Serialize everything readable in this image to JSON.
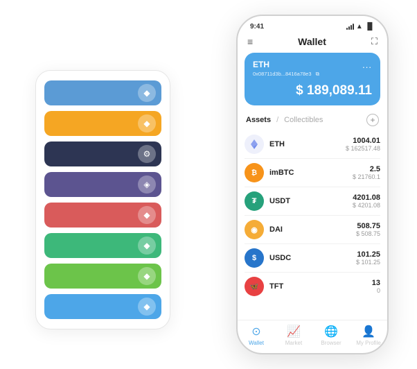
{
  "scene": {
    "card_stack": {
      "cards": [
        {
          "id": "blue",
          "class": "card-blue",
          "icon": "◆"
        },
        {
          "id": "orange",
          "class": "card-orange",
          "icon": "◆"
        },
        {
          "id": "dark",
          "class": "card-dark",
          "icon": "⚙"
        },
        {
          "id": "purple",
          "class": "card-purple",
          "icon": "◆"
        },
        {
          "id": "red",
          "class": "card-red",
          "icon": "◆"
        },
        {
          "id": "green",
          "class": "card-green",
          "icon": "◆"
        },
        {
          "id": "lightgreen",
          "class": "card-lightgreen",
          "icon": "◆"
        },
        {
          "id": "skyblue",
          "class": "card-skyblue",
          "icon": "◆"
        }
      ]
    },
    "phone": {
      "status_bar": {
        "time": "9:41",
        "battery": "▐",
        "wifi": "wifi",
        "signal": "signal"
      },
      "header": {
        "menu_icon": "≡",
        "title": "Wallet",
        "expand_icon": "⛶"
      },
      "eth_card": {
        "coin": "ETH",
        "address": "0x08711d3b...8416a78e3",
        "copy_icon": "⧉",
        "menu": "...",
        "currency": "$",
        "amount": "189,089.11"
      },
      "assets_section": {
        "tab_active": "Assets",
        "tab_divider": "/",
        "tab_inactive": "Collectibles",
        "add_icon": "+"
      },
      "assets": [
        {
          "name": "ETH",
          "amount": "1004.01",
          "usd": "$ 162517.48",
          "icon_type": "eth"
        },
        {
          "name": "imBTC",
          "amount": "2.5",
          "usd": "$ 21760.1",
          "icon_type": "imbtc"
        },
        {
          "name": "USDT",
          "amount": "4201.08",
          "usd": "$ 4201.08",
          "icon_type": "usdt"
        },
        {
          "name": "DAI",
          "amount": "508.75",
          "usd": "$ 508.75",
          "icon_type": "dai"
        },
        {
          "name": "USDC",
          "amount": "101.25",
          "usd": "$ 101.25",
          "icon_type": "usdc"
        },
        {
          "name": "TFT",
          "amount": "13",
          "usd": "0",
          "icon_type": "tft"
        }
      ],
      "bottom_nav": [
        {
          "id": "wallet",
          "label": "Wallet",
          "active": true
        },
        {
          "id": "market",
          "label": "Market",
          "active": false
        },
        {
          "id": "browser",
          "label": "Browser",
          "active": false
        },
        {
          "id": "profile",
          "label": "My Profile",
          "active": false
        }
      ]
    }
  }
}
